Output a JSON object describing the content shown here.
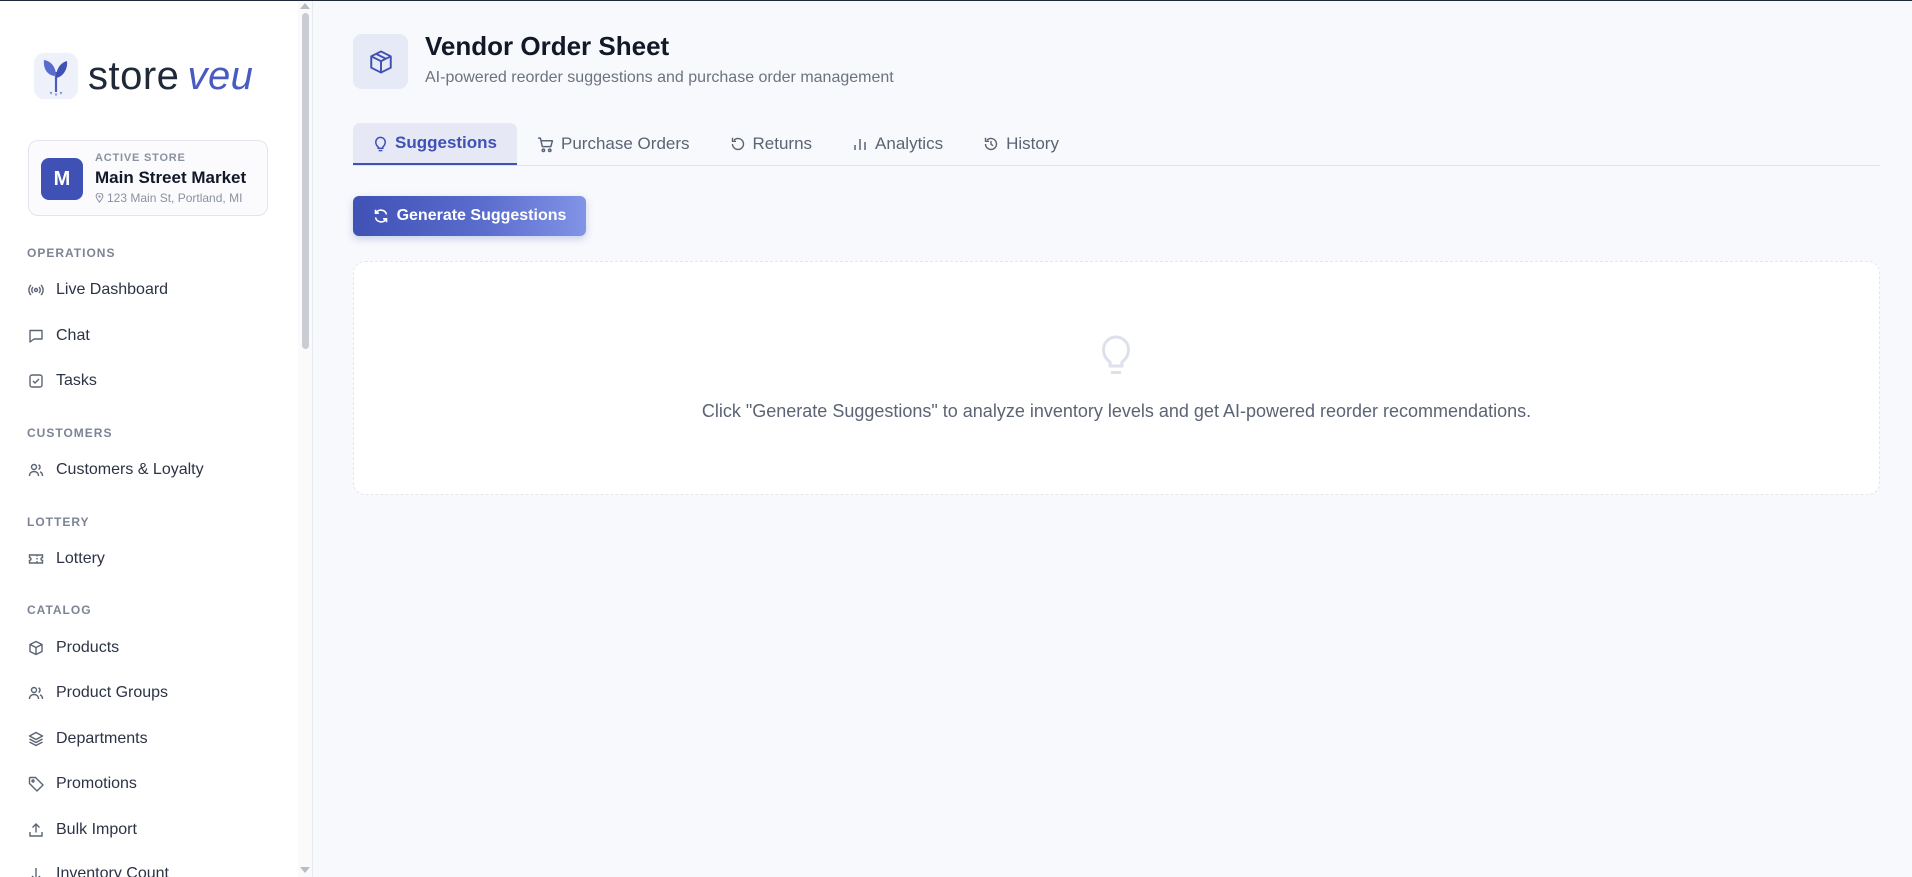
{
  "brand": {
    "name_main": "store",
    "name_accent": "veu",
    "accent_color": "#4a5bbf"
  },
  "store": {
    "kicker": "ACTIVE STORE",
    "avatar_letter": "M",
    "name": "Main Street Market",
    "address": "123 Main St, Portland, MI"
  },
  "sidebar": {
    "sections": {
      "operations": "OPERATIONS",
      "customers": "CUSTOMERS",
      "lottery": "LOTTERY",
      "catalog": "CATALOG"
    },
    "items": {
      "live_dashboard": "Live Dashboard",
      "chat": "Chat",
      "tasks": "Tasks",
      "customers_loyalty": "Customers & Loyalty",
      "lottery": "Lottery",
      "products": "Products",
      "product_groups": "Product Groups",
      "departments": "Departments",
      "promotions": "Promotions",
      "bulk_import": "Bulk Import",
      "inventory_count": "Inventory Count"
    },
    "icons": {
      "live_dashboard": "broadcast-icon",
      "chat": "chat-icon",
      "tasks": "checkbox-icon",
      "customers_loyalty": "users-icon",
      "lottery": "ticket-icon",
      "products": "box-icon",
      "product_groups": "users-icon",
      "departments": "layers-icon",
      "promotions": "tag-icon",
      "bulk_import": "upload-icon",
      "inventory_count": "clipboard-icon"
    }
  },
  "page": {
    "title": "Vendor Order Sheet",
    "subtitle": "AI-powered reorder suggestions and purchase order management",
    "icon": "box-icon"
  },
  "tabs": {
    "suggestions": "Suggestions",
    "purchase_orders": "Purchase Orders",
    "returns": "Returns",
    "analytics": "Analytics",
    "history": "History",
    "active": "Suggestions"
  },
  "actions": {
    "generate": "Generate Suggestions"
  },
  "empty_state": {
    "icon": "lightbulb-icon",
    "message": "Click \"Generate Suggestions\" to analyze inventory levels and get AI-powered reorder recommendations."
  },
  "colors": {
    "primary": "#3f51b5",
    "background": "#f8f9fc",
    "sidebar_bg": "#ffffff"
  }
}
